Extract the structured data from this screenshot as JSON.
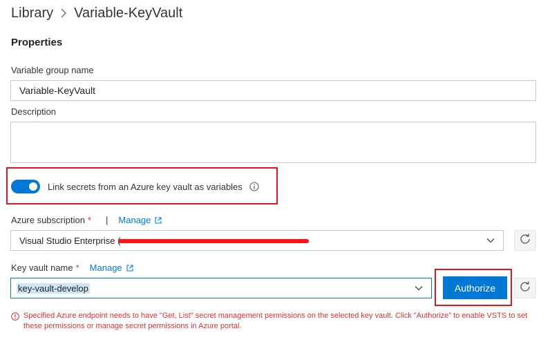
{
  "breadcrumb": {
    "root": "Library",
    "separator_icon": "chevron-right-icon",
    "current": "Variable-KeyVault"
  },
  "properties": {
    "title": "Properties",
    "group_name_label": "Variable group name",
    "group_name_value": "Variable-KeyVault",
    "description_label": "Description",
    "description_value": ""
  },
  "link_secrets": {
    "label": "Link secrets from an Azure key vault as variables",
    "enabled": true,
    "info_icon": "info-icon"
  },
  "subscription": {
    "label": "Azure subscription",
    "required_mark": "*",
    "separator": "|",
    "manage_label": "Manage",
    "selected": "Visual Studio Enterprise (",
    "redacted": true
  },
  "key_vault": {
    "label": "Key vault name",
    "required_mark": "*",
    "manage_label": "Manage",
    "selected": "key-vault-develop",
    "authorize_label": "Authorize"
  },
  "error": {
    "message": "Specified Azure endpoint needs to have \"Get, List\" secret management permissions on the selected key vault. Click \"Authorize\" to enable VSTS to set these permissions or manage secret permissions in Azure portal."
  },
  "colors": {
    "accent": "#0078d4",
    "error": "#d13438",
    "highlight": "#e0141e"
  }
}
